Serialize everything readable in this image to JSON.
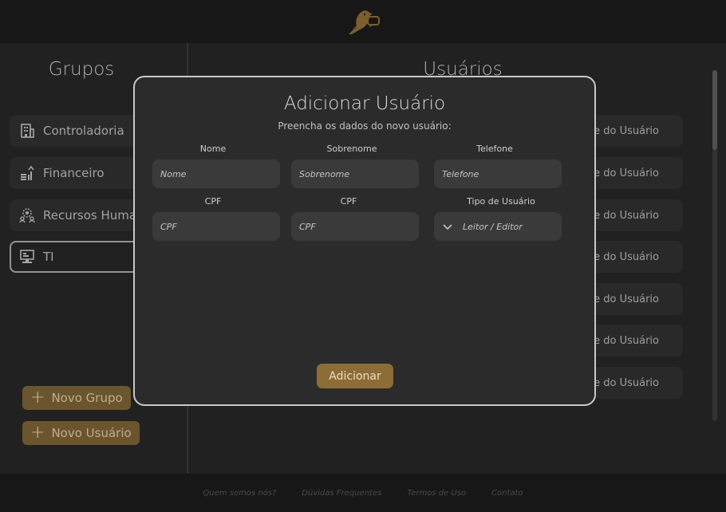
{
  "header": {
    "logo_icon": "bird-chat-logo-icon"
  },
  "groups": {
    "title": "Grupos",
    "items": [
      {
        "label": "Controladoria",
        "icon": "building-icon"
      },
      {
        "label": "Financeiro",
        "icon": "money-chart-icon"
      },
      {
        "label": "Recursos Humanos",
        "icon": "people-gear-icon"
      },
      {
        "label": "TI",
        "icon": "computer-icon",
        "selected": true
      }
    ],
    "new_group_label": "Novo Grupo",
    "new_user_label": "Novo Usuário"
  },
  "users": {
    "title": "Usuários",
    "items": [
      {
        "label": "Nome do Usuário"
      },
      {
        "label": "Nome do Usuário"
      },
      {
        "label": "Nome do Usuário"
      },
      {
        "label": "Nome do Usuário"
      },
      {
        "label": "Nome do Usuário"
      },
      {
        "label": "Nome do Usuário"
      },
      {
        "label": "Nome do Usuário"
      }
    ]
  },
  "modal": {
    "title": "Adicionar Usuário",
    "subtitle": "Preencha os dados do novo usuário:",
    "fields": {
      "nome": {
        "label": "Nome",
        "placeholder": "Nome",
        "value": ""
      },
      "sobrenome": {
        "label": "Sobrenome",
        "placeholder": "Sobrenome",
        "value": ""
      },
      "telefone": {
        "label": "Telefone",
        "placeholder": "Telefone",
        "value": ""
      },
      "cpf1": {
        "label": "CPF",
        "placeholder": "CPF",
        "value": ""
      },
      "cpf2": {
        "label": "CPF",
        "placeholder": "CPF",
        "value": ""
      },
      "tipo": {
        "label": "Tipo de Usuário",
        "selected": "Leitor / Editor"
      }
    },
    "submit_label": "Adicionar"
  },
  "footer": {
    "links": [
      "Quem somos nós?",
      "Dúvidas Frequentes",
      "Termos de Uso",
      "Contato"
    ]
  },
  "colors": {
    "accent": "#8c6d36",
    "background": "#262626",
    "panel": "#2f2f2f"
  }
}
